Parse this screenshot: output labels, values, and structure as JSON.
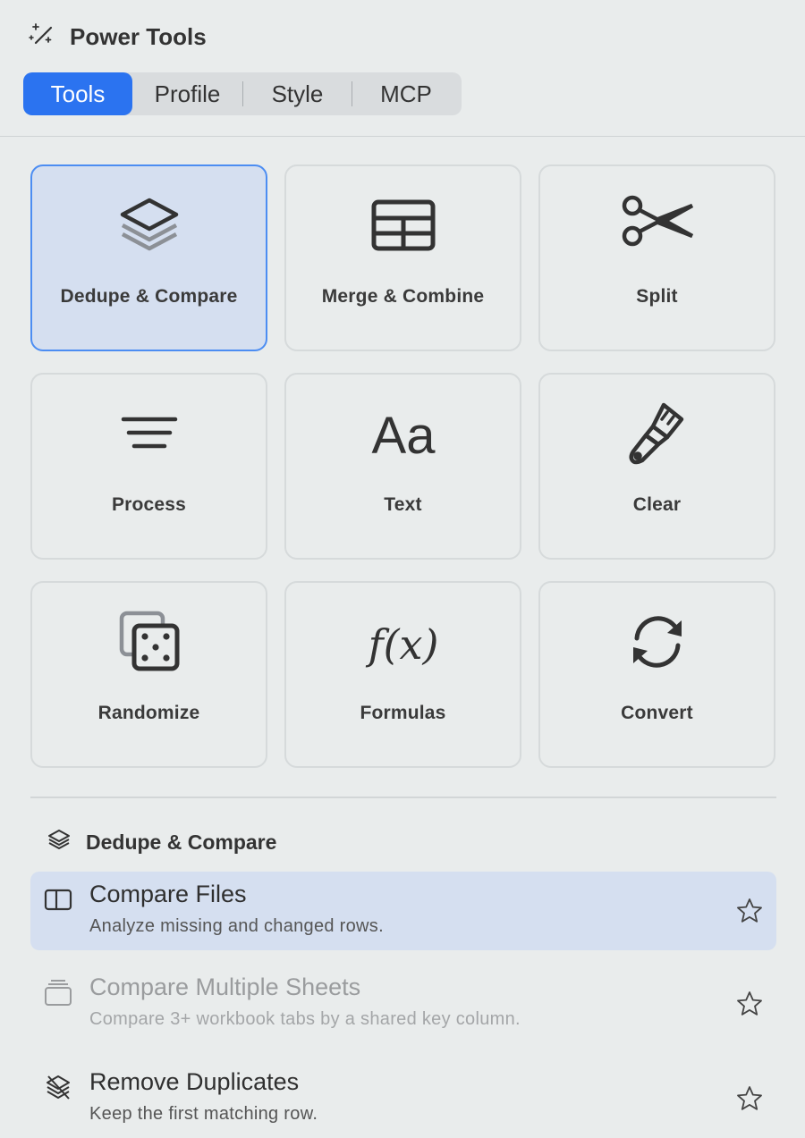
{
  "app": {
    "title": "Power Tools"
  },
  "tabs": [
    {
      "label": "Tools",
      "active": true
    },
    {
      "label": "Profile",
      "active": false
    },
    {
      "label": "Style",
      "active": false
    },
    {
      "label": "MCP",
      "active": false
    }
  ],
  "tool_grid": [
    {
      "label": "Dedupe & Compare",
      "icon": "layers-icon",
      "selected": true
    },
    {
      "label": "Merge & Combine",
      "icon": "table-icon",
      "selected": false
    },
    {
      "label": "Split",
      "icon": "scissors-icon",
      "selected": false
    },
    {
      "label": "Process",
      "icon": "lines-icon",
      "selected": false
    },
    {
      "label": "Text",
      "icon": "text-aa-icon",
      "selected": false
    },
    {
      "label": "Clear",
      "icon": "brush-icon",
      "selected": false
    },
    {
      "label": "Randomize",
      "icon": "dice-icon",
      "selected": false
    },
    {
      "label": "Formulas",
      "icon": "function-icon",
      "selected": false
    },
    {
      "label": "Convert",
      "icon": "refresh-icon",
      "selected": false
    }
  ],
  "icon_text": {
    "text": "Aa",
    "formula": "f(x)"
  },
  "section": {
    "title": "Dedupe & Compare",
    "icon": "layers-icon"
  },
  "tools": [
    {
      "name": "Compare Files",
      "desc": "Analyze missing and changed rows.",
      "icon": "split-panel-icon",
      "active": true,
      "disabled": false
    },
    {
      "name": "Compare Multiple Sheets",
      "desc": "Compare 3+ workbook tabs by a shared key column.",
      "icon": "stack-icon",
      "active": false,
      "disabled": true
    },
    {
      "name": "Remove Duplicates",
      "desc": "Keep the first matching row.",
      "icon": "layers-slash-icon",
      "active": false,
      "disabled": false
    }
  ],
  "colors": {
    "accent": "#2b73f0",
    "selected_bg": "#d5dff0",
    "selected_border": "#4c8df2",
    "background": "#e9ecec"
  }
}
